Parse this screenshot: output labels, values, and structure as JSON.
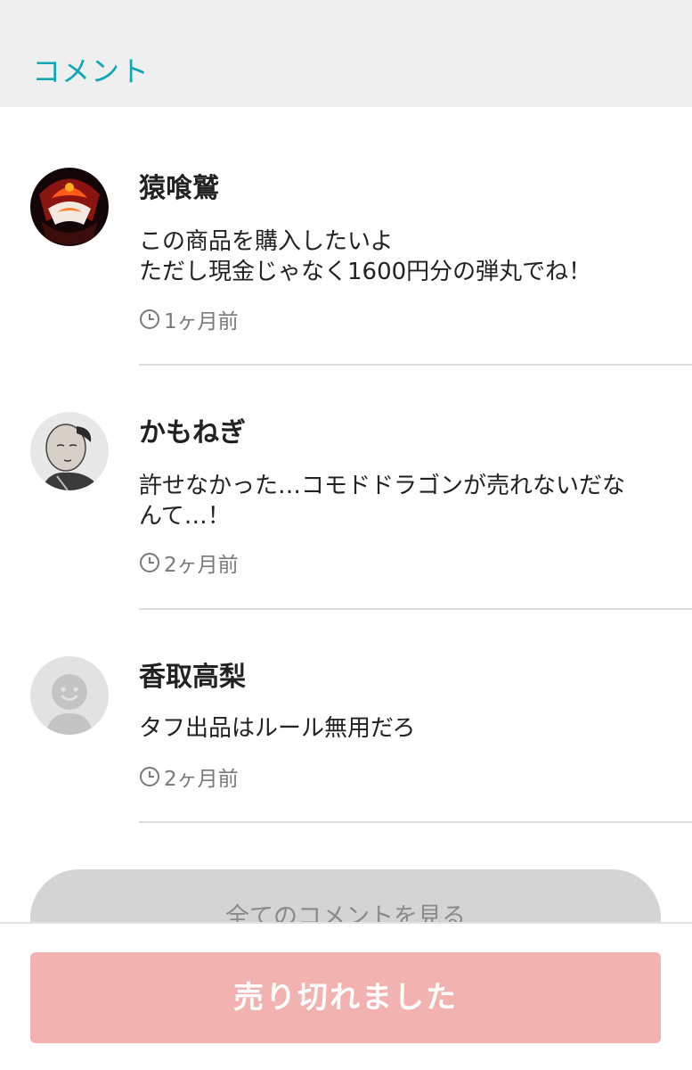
{
  "header": {
    "title": "コメント"
  },
  "comments": [
    {
      "name": "猿喰鷲",
      "text": "この商品を購入したいよ\nただし現金じゃなく1600円分の弾丸でね！",
      "time": "1ヶ月前",
      "avatar": "red-mask-avatar"
    },
    {
      "name": "かもねぎ",
      "text": "許せなかった…コモドドラゴンが売れないだな\nんて…！",
      "time": "2ヶ月前",
      "avatar": "portrait-sketch-avatar"
    },
    {
      "name": "香取高梨",
      "text": "タフ出品はルール無用だろ",
      "time": "2ヶ月前",
      "avatar": "default-smiley-avatar"
    }
  ],
  "view_all_label": "全てのコメントを見る",
  "sold_out_label": "売り切れました",
  "colors": {
    "accent": "#11a8b6",
    "sold_out": "#f2b3b0"
  }
}
